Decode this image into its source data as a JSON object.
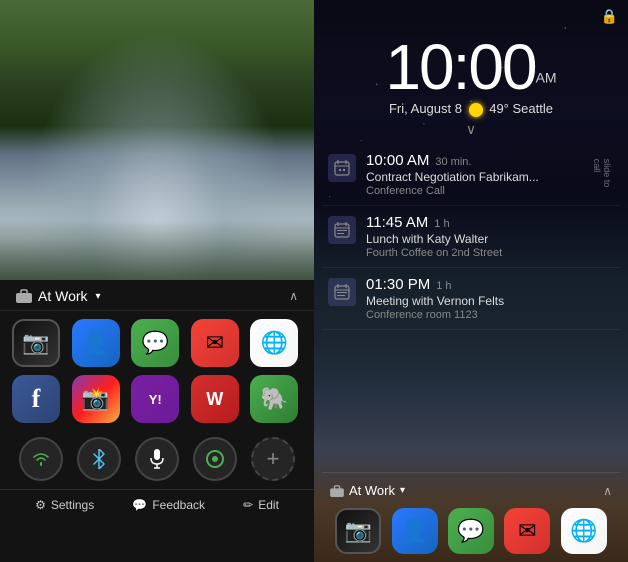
{
  "left": {
    "at_work_label": "At Work",
    "dropdown_arrow": "▾",
    "chevron_up": "∧",
    "apps": [
      {
        "name": "Camera",
        "class": "camera",
        "icon": "📷"
      },
      {
        "name": "Contacts",
        "class": "contacts",
        "icon": "👤"
      },
      {
        "name": "Hangouts",
        "class": "hangouts",
        "icon": "💬"
      },
      {
        "name": "Gmail",
        "class": "gmail",
        "icon": "✉"
      },
      {
        "name": "Chrome",
        "class": "chrome",
        "icon": "🌐"
      },
      {
        "name": "Facebook",
        "class": "facebook",
        "icon": "f"
      },
      {
        "name": "Instagram",
        "class": "instagram",
        "icon": "📸"
      },
      {
        "name": "Yahoo",
        "class": "yahoo",
        "icon": "Y!"
      },
      {
        "name": "Office",
        "class": "office",
        "icon": "W"
      },
      {
        "name": "Evernote",
        "class": "evernote",
        "icon": "🐘"
      }
    ],
    "quick_actions": [
      {
        "name": "WiFi",
        "icon": "wifi"
      },
      {
        "name": "Bluetooth",
        "icon": "bt"
      },
      {
        "name": "Microphone",
        "icon": "mic"
      },
      {
        "name": "Shape",
        "icon": "shape"
      },
      {
        "name": "Add",
        "icon": "plus"
      }
    ],
    "bottom": {
      "settings_label": "Settings",
      "feedback_label": "Feedback",
      "edit_label": "Edit",
      "settings_icon": "⚙",
      "feedback_icon": "💬",
      "edit_icon": "✏"
    }
  },
  "right": {
    "lock_icon": "🔒",
    "time": "10:00",
    "am_label": "AM",
    "date": "Fri, August 8",
    "temperature": "49°",
    "city": "Seattle",
    "chevron_down": "∨",
    "events": [
      {
        "time": "10:00 AM",
        "duration": "30 min.",
        "title": "Contract Negotiation Fabrikam...",
        "location": "Conference Call"
      },
      {
        "time": "11:45 AM",
        "duration": "1 h",
        "title": "Lunch with Katy Walter",
        "location": "Fourth Coffee on 2nd Street"
      },
      {
        "time": "01:30 PM",
        "duration": "1 h",
        "title": "Meeting with Vernon Felts",
        "location": "Conference room 1123"
      }
    ],
    "slide_to_call": "slide to call",
    "at_work_label": "At Work",
    "lock_apps": [
      {
        "name": "Camera",
        "class": "camera",
        "icon": "📷"
      },
      {
        "name": "Contacts",
        "class": "contacts",
        "icon": "👤"
      },
      {
        "name": "Hangouts",
        "class": "hangouts",
        "icon": "💬"
      },
      {
        "name": "Gmail",
        "class": "gmail",
        "icon": "✉"
      },
      {
        "name": "Chrome",
        "class": "chrome",
        "icon": "🌐"
      }
    ]
  }
}
